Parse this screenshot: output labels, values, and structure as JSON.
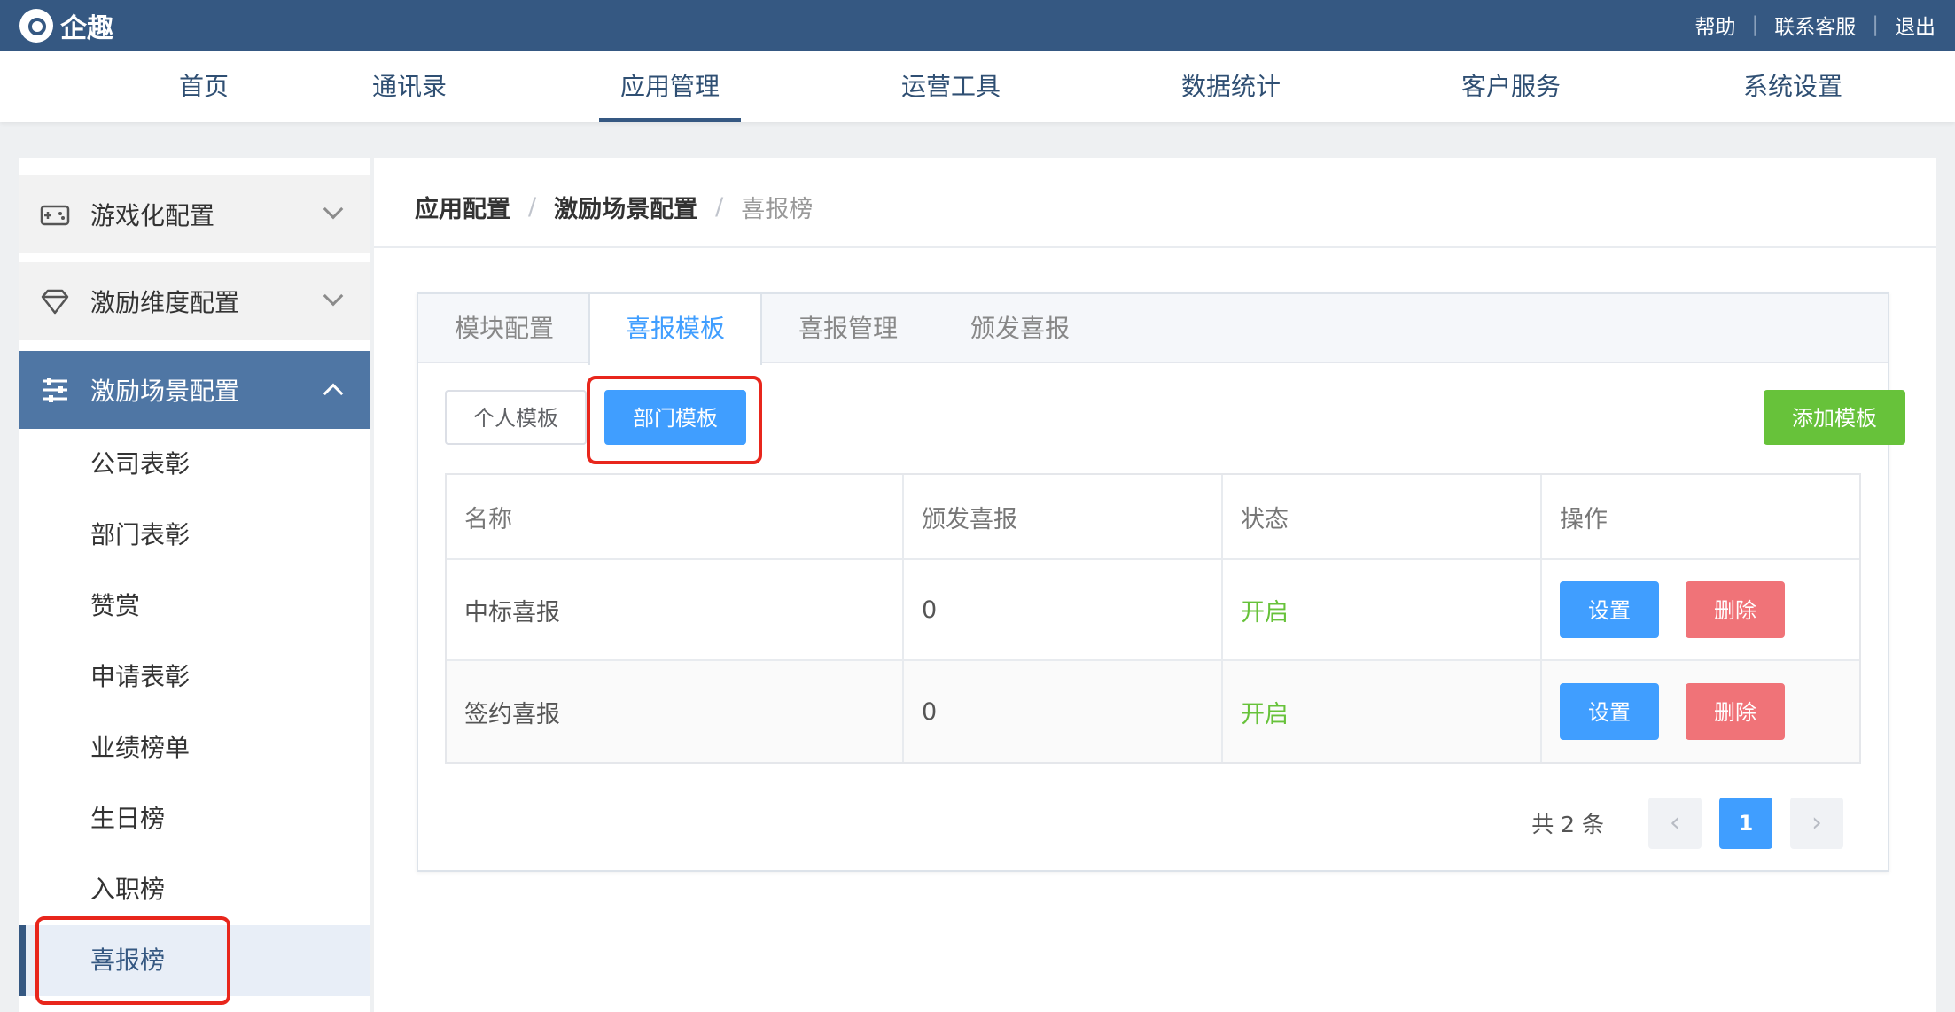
{
  "app": {
    "name": "企趣"
  },
  "top_links": [
    "帮助",
    "联系客服",
    "退出"
  ],
  "main_nav": [
    "首页",
    "通讯录",
    "应用管理",
    "运营工具",
    "数据统计",
    "客户服务",
    "系统设置"
  ],
  "main_nav_active": "应用管理",
  "sidebar": {
    "groups": [
      {
        "label": "游戏化配置",
        "icon": "gamepad-icon",
        "open": false
      },
      {
        "label": "激励维度配置",
        "icon": "diamond-icon",
        "open": false
      },
      {
        "label": "激励场景配置",
        "icon": "sliders-icon",
        "open": true
      }
    ],
    "sub_items": [
      "公司表彰",
      "部门表彰",
      "赞赏",
      "申请表彰",
      "业绩榜单",
      "生日榜",
      "入职榜",
      "喜报榜"
    ],
    "active_item": "喜报榜"
  },
  "breadcrumb": [
    "应用配置",
    "激励场景配置",
    "喜报榜"
  ],
  "tabs": [
    "模块配置",
    "喜报模板",
    "喜报管理",
    "颁发喜报"
  ],
  "active_tab": "喜报模板",
  "template_switch": {
    "personal": "个人模板",
    "department": "部门模板",
    "active": "部门模板"
  },
  "add_button": "添加模板",
  "table": {
    "headers": [
      "名称",
      "颁发喜报",
      "状态",
      "操作"
    ],
    "rows": [
      {
        "name": "中标喜报",
        "issued": "0",
        "status": "开启",
        "actions": [
          "设置",
          "删除"
        ]
      },
      {
        "name": "签约喜报",
        "issued": "0",
        "status": "开启",
        "actions": [
          "设置",
          "删除"
        ]
      }
    ]
  },
  "pagination": {
    "total_text": "共 2 条",
    "current_page": "1",
    "prev": "‹",
    "next": "›"
  },
  "colors": {
    "header_bg": "#355882",
    "primary": "#409eff",
    "success": "#67c23a",
    "danger": "#f07378",
    "highlight": "#e8261c"
  }
}
